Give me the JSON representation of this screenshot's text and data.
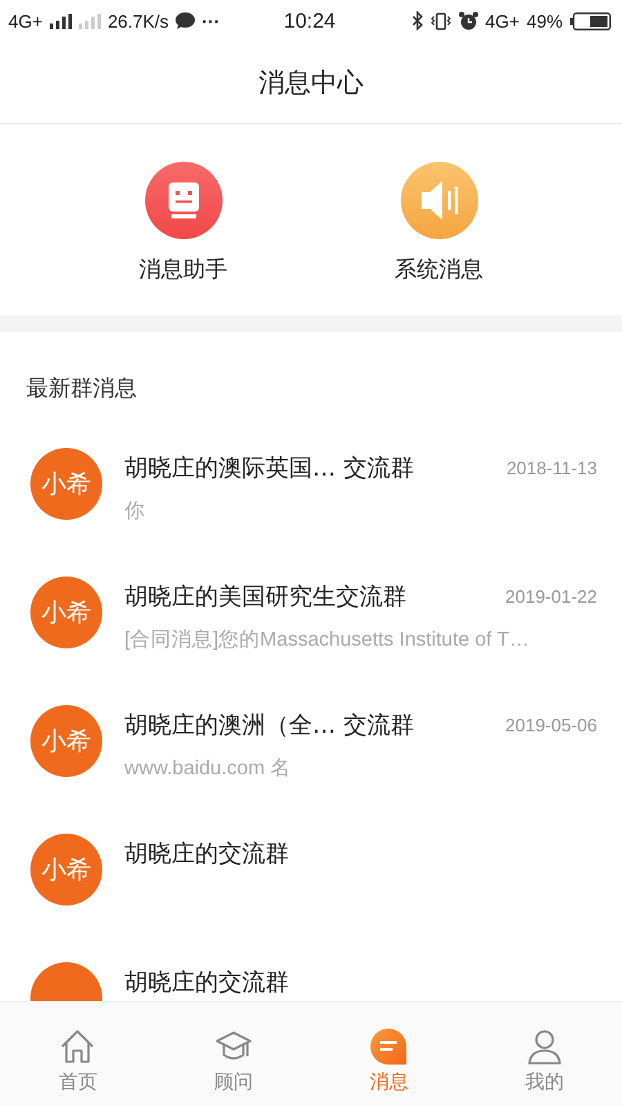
{
  "status_bar": {
    "network_left": "4G+",
    "speed": "26.7K/s",
    "more": "···",
    "time": "10:24",
    "network_right": "4G+",
    "battery": "49%"
  },
  "header": {
    "title": "消息中心"
  },
  "shortcuts": [
    {
      "kind": "robot",
      "label": "消息助手"
    },
    {
      "kind": "speaker",
      "label": "系统消息"
    }
  ],
  "section_title": "最新群消息",
  "groups": [
    {
      "avatar": "小希",
      "title": "胡晓庄的澳际英国… 交流群",
      "date": "2018-11-13",
      "preview": "你"
    },
    {
      "avatar": "小希",
      "title": "胡晓庄的美国研究生交流群",
      "date": "2019-01-22",
      "preview": "[合同消息]您的Massachusetts Institute of T…"
    },
    {
      "avatar": "小希",
      "title": "胡晓庄的澳洲（全… 交流群",
      "date": "2019-05-06",
      "preview": "www.baidu.com 名"
    },
    {
      "avatar": "小希",
      "title": "胡晓庄的交流群"
    },
    {
      "title": "胡晓庄的交流群"
    }
  ],
  "tabs": [
    {
      "kind": "home",
      "label": "首页",
      "selected": false
    },
    {
      "kind": "cap",
      "label": "顾问",
      "selected": false
    },
    {
      "kind": "message",
      "label": "消息",
      "selected": true
    },
    {
      "kind": "person",
      "label": "我的",
      "selected": false
    }
  ]
}
